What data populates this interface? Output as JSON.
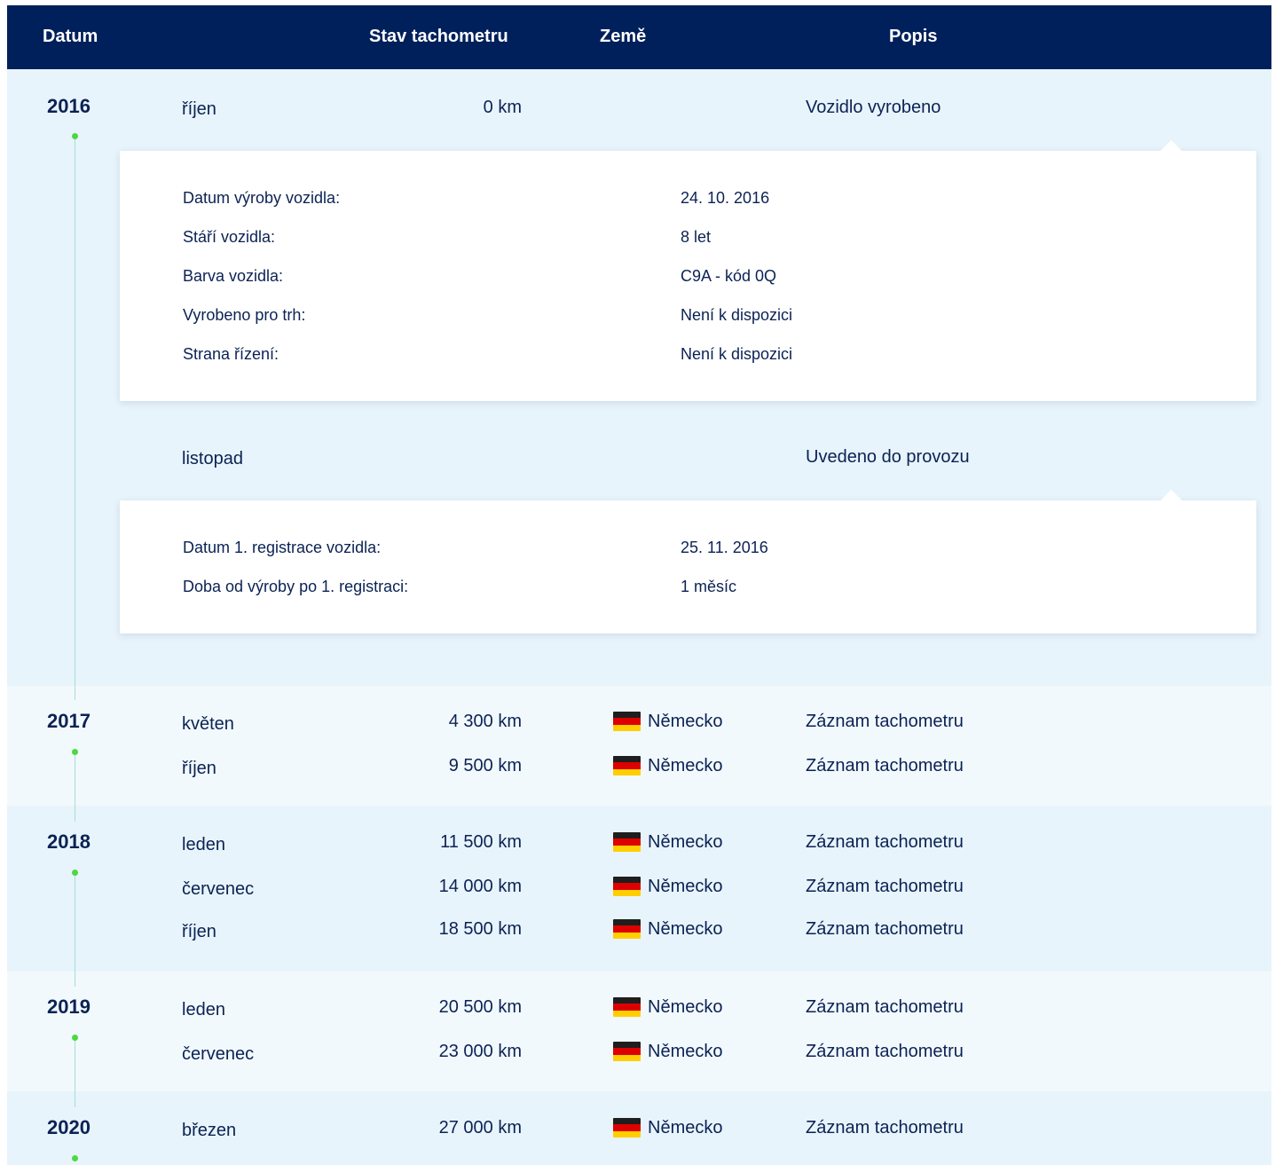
{
  "header": {
    "datum": "Datum",
    "stav": "Stav tachometru",
    "zeme": "Země",
    "popis": "Popis"
  },
  "colors": {
    "header_bg": "#00205b",
    "text": "#0b2254",
    "band_dark": "#e8f4fb",
    "band_light": "#f2f9fd",
    "timeline_dot": "#4cd840",
    "timeline_line": "#a8ddd0"
  },
  "y2016": {
    "year": "2016",
    "rows": [
      {
        "month": "říjen",
        "km": "0 km",
        "desc": "Vozidlo vyrobeno"
      },
      {
        "month": "listopad",
        "desc": "Uvedeno do provozu"
      }
    ],
    "card1": {
      "rows": [
        {
          "label": "Datum výroby vozidla:",
          "value": "24. 10. 2016"
        },
        {
          "label": "Stáří vozidla:",
          "value": "8 let"
        },
        {
          "label": "Barva vozidla:",
          "value": "C9A - kód 0Q"
        },
        {
          "label": "Vyrobeno pro trh:",
          "value": "Není k dispozici"
        },
        {
          "label": "Strana řízení:",
          "value": "Není k dispozici"
        }
      ]
    },
    "card2": {
      "rows": [
        {
          "label": "Datum 1. registrace vozidla:",
          "value": "25. 11. 2016"
        },
        {
          "label": "Doba od výroby po 1. registraci:",
          "value": "1 měsíc"
        }
      ]
    }
  },
  "y2017": {
    "year": "2017",
    "rows": [
      {
        "month": "květen",
        "km": "4 300 km",
        "country": "Německo",
        "desc": "Záznam tachometru"
      },
      {
        "month": "říjen",
        "km": "9 500 km",
        "country": "Německo",
        "desc": "Záznam tachometru"
      }
    ]
  },
  "y2018": {
    "year": "2018",
    "rows": [
      {
        "month": "leden",
        "km": "11 500 km",
        "country": "Německo",
        "desc": "Záznam tachometru"
      },
      {
        "month": "červenec",
        "km": "14 000 km",
        "country": "Německo",
        "desc": "Záznam tachometru"
      },
      {
        "month": "říjen",
        "km": "18 500 km",
        "country": "Německo",
        "desc": "Záznam tachometru"
      }
    ]
  },
  "y2019": {
    "year": "2019",
    "rows": [
      {
        "month": "leden",
        "km": "20 500 km",
        "country": "Německo",
        "desc": "Záznam tachometru"
      },
      {
        "month": "červenec",
        "km": "23 000 km",
        "country": "Německo",
        "desc": "Záznam tachometru"
      }
    ]
  },
  "y2020": {
    "year": "2020",
    "rows": [
      {
        "month": "březen",
        "km": "27 000 km",
        "country": "Německo",
        "desc": "Záznam tachometru"
      }
    ]
  },
  "icons": {
    "flag": "germany-flag-icon"
  }
}
